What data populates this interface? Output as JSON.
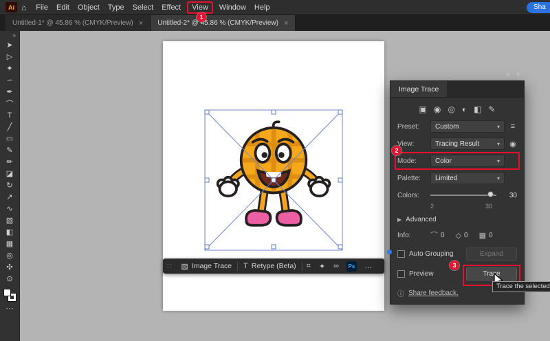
{
  "menu": {
    "logo": "Ai",
    "home_icon": "⌂",
    "items": [
      "File",
      "Edit",
      "Object",
      "Type",
      "Select",
      "Effect",
      "View",
      "Window",
      "Help"
    ],
    "share_label": "Sha"
  },
  "annotations": {
    "step1": "1",
    "step2": "2",
    "step3": "3"
  },
  "tabs": [
    {
      "label": "Untitled-1* @ 45.86 % (CMYK/Preview)",
      "close_icon": "×"
    },
    {
      "label": "Untitled-2* @ 45.86 % (CMYK/Preview)",
      "close_icon": "×"
    }
  ],
  "toolbar": {
    "collapse_icon": "»",
    "tools": [
      {
        "name": "selection-tool-icon",
        "glyph": "➤"
      },
      {
        "name": "direct-selection-tool-icon",
        "glyph": "▷"
      },
      {
        "name": "magic-wand-tool-icon",
        "glyph": "✦"
      },
      {
        "name": "lasso-tool-icon",
        "glyph": "∽"
      },
      {
        "name": "pen-tool-icon",
        "glyph": "✒"
      },
      {
        "name": "curvature-tool-icon",
        "glyph": "⌒"
      },
      {
        "name": "type-tool-icon",
        "glyph": "T"
      },
      {
        "name": "line-segment-tool-icon",
        "glyph": "╱"
      },
      {
        "name": "rectangle-tool-icon",
        "glyph": "▭"
      },
      {
        "name": "paintbrush-tool-icon",
        "glyph": "✎"
      },
      {
        "name": "pencil-tool-icon",
        "glyph": "✏"
      },
      {
        "name": "eraser-tool-icon",
        "glyph": "◪"
      },
      {
        "name": "rotate-tool-icon",
        "glyph": "↻"
      },
      {
        "name": "scale-tool-icon",
        "glyph": "↗"
      },
      {
        "name": "width-tool-icon",
        "glyph": "∿"
      },
      {
        "name": "shape-builder-tool-icon",
        "glyph": "▧"
      },
      {
        "name": "gradient-tool-icon",
        "glyph": "◧"
      },
      {
        "name": "mesh-tool-icon",
        "glyph": "▦"
      },
      {
        "name": "eyedropper-tool-icon",
        "glyph": "◎"
      },
      {
        "name": "hand-tool-icon",
        "glyph": "✣"
      },
      {
        "name": "zoom-tool-icon",
        "glyph": "⊙"
      }
    ],
    "more_icon": "⋯"
  },
  "context_bar": {
    "grip_icon": "∷",
    "image_trace_icon": "▨",
    "image_trace_label": "Image Trace",
    "retype_icon": "T",
    "retype_label": "Retype (Beta)",
    "crop_icon": "⌗",
    "sparkle_icon": "✦",
    "link_icon": "∞",
    "ps_label": "Ps",
    "more_icon": "…"
  },
  "panel": {
    "title": "Image Trace",
    "collapse_icon": "«",
    "close_icon": "×",
    "preset_icons": [
      {
        "name": "preset-auto-color-icon",
        "glyph": "▣"
      },
      {
        "name": "preset-high-color-icon",
        "glyph": "◉"
      },
      {
        "name": "preset-low-color-icon",
        "glyph": "◎"
      },
      {
        "name": "preset-grayscale-icon",
        "glyph": "◐"
      },
      {
        "name": "preset-black-white-icon",
        "glyph": "◧"
      },
      {
        "name": "preset-outline-icon",
        "glyph": "✎"
      }
    ],
    "chevron_icon": "▾",
    "preset_label": "Preset:",
    "preset_value": "Custom",
    "preset_menu_icon": "≡",
    "view_label": "View:",
    "view_value": "Tracing Result",
    "eye_icon": "◉",
    "mode_label": "Mode:",
    "mode_value": "Color",
    "palette_label": "Palette:",
    "palette_value": "Limited",
    "colors_label": "Colors:",
    "colors_value": "30",
    "colors_min": "2",
    "colors_max": "30",
    "advanced_arrow": "▶",
    "advanced_label": "Advanced",
    "info_label": "Info:",
    "paths_icon": "⌒",
    "paths_value": "0",
    "anchors_icon": "◇",
    "anchors_value": "0",
    "swatches_icon": "▦",
    "swatches_value": "0",
    "auto_grouping_label": "Auto Grouping",
    "expand_label": "Expand",
    "preview_label": "Preview",
    "trace_label": "Trace",
    "tooltip": "Trace the selected",
    "feedback_icon": "ⓘ",
    "feedback_label": "Share feedback."
  }
}
